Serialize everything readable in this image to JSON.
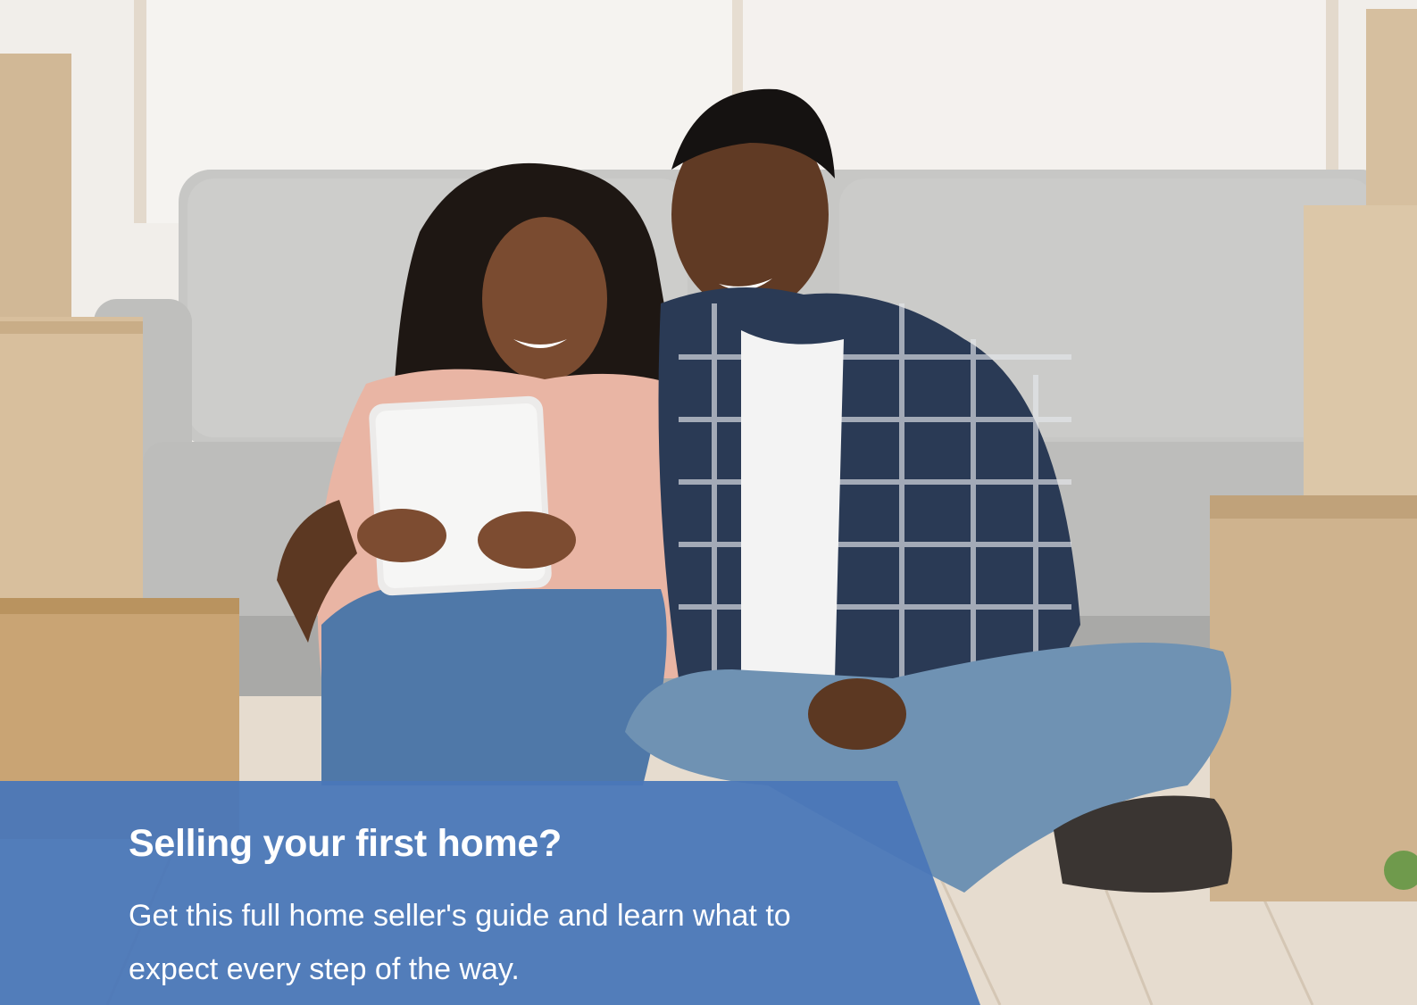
{
  "promo": {
    "headline": "Selling your first home?",
    "body": "Get this full home seller's guide and learn what to expect every step of the way.",
    "accent_color": "#4a77b8"
  },
  "image": {
    "description_icon": "couple-with-tablet-photo"
  }
}
